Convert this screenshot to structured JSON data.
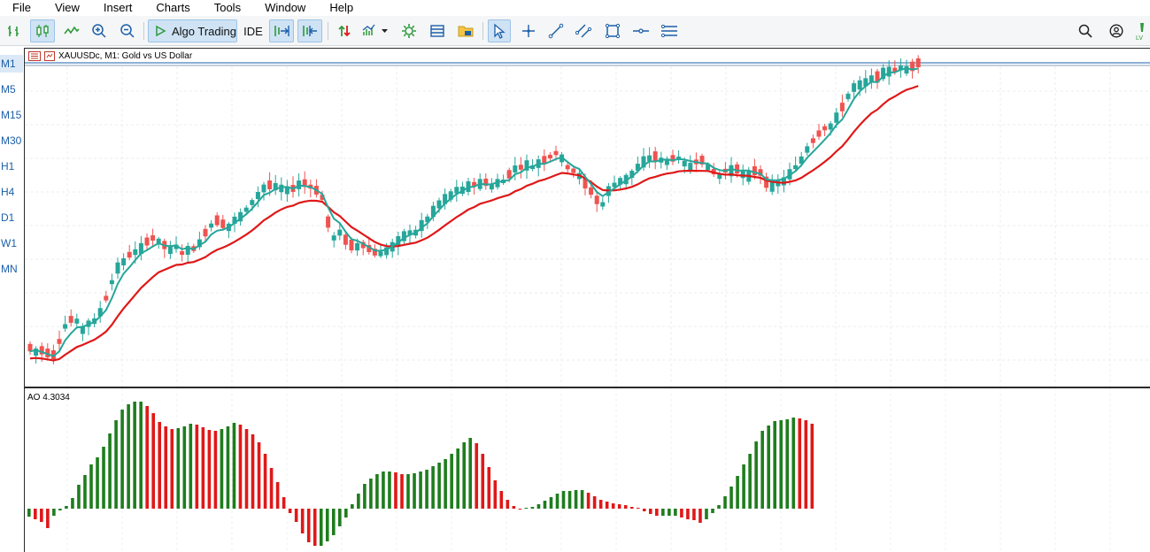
{
  "menu": [
    "File",
    "View",
    "Insert",
    "Charts",
    "Tools",
    "Window",
    "Help"
  ],
  "toolbar": {
    "algo_trading_label": "Algo Trading",
    "ide_label": "IDE",
    "colors": {
      "active_bg": "#cfe3f5",
      "icon_blue": "#1b5fa8",
      "icon_green": "#2e9a3c"
    }
  },
  "timeframes": [
    "M1",
    "M5",
    "M15",
    "M30",
    "H1",
    "H4",
    "D1",
    "W1",
    "MN"
  ],
  "active_timeframe": "M1",
  "chart": {
    "symbol_title": "XAUUSDc, M1:  Gold vs US Dollar",
    "ao_label": "AO 4.3034",
    "colors": {
      "bull": "#26a69a",
      "bear": "#ef5350",
      "fast_ma": "#26a69a",
      "slow_ma": "#e01818",
      "ao_up": "#1e7d1e",
      "ao_down": "#e01818"
    }
  },
  "chart_data": [
    {
      "type": "candlestick",
      "candles_approx": [
        [
          0,
          392
        ],
        [
          1,
          397
        ],
        [
          2,
          395
        ],
        [
          3,
          398
        ],
        [
          4,
          400
        ],
        [
          5,
          385
        ],
        [
          6,
          368
        ],
        [
          7,
          360
        ],
        [
          8,
          362
        ],
        [
          9,
          372
        ],
        [
          10,
          365
        ],
        [
          11,
          362
        ],
        [
          12,
          352
        ],
        [
          13,
          336
        ],
        [
          14,
          318
        ],
        [
          15,
          302
        ],
        [
          16,
          295
        ],
        [
          17,
          287
        ],
        [
          18,
          284
        ],
        [
          19,
          280
        ],
        [
          20,
          272
        ],
        [
          21,
          268
        ],
        [
          22,
          272
        ],
        [
          23,
          276
        ],
        [
          24,
          282
        ],
        [
          25,
          278
        ],
        [
          26,
          285
        ],
        [
          27,
          282
        ],
        [
          28,
          280
        ],
        [
          29,
          274
        ],
        [
          30,
          262
        ],
        [
          31,
          254
        ],
        [
          32,
          248
        ],
        [
          33,
          252
        ],
        [
          34,
          256
        ],
        [
          35,
          248
        ],
        [
          36,
          244
        ],
        [
          37,
          236
        ],
        [
          38,
          228
        ],
        [
          39,
          220
        ],
        [
          40,
          212
        ],
        [
          41,
          208
        ],
        [
          42,
          210
        ],
        [
          43,
          212
        ],
        [
          44,
          214
        ],
        [
          45,
          212
        ],
        [
          46,
          208
        ],
        [
          47,
          206
        ],
        [
          48,
          210
        ],
        [
          49,
          214
        ],
        [
          50,
          222
        ],
        [
          51,
          250
        ],
        [
          52,
          268
        ],
        [
          53,
          262
        ],
        [
          54,
          270
        ],
        [
          55,
          276
        ],
        [
          56,
          278
        ],
        [
          57,
          276
        ],
        [
          58,
          280
        ],
        [
          59,
          284
        ],
        [
          60,
          286
        ],
        [
          61,
          283
        ],
        [
          62,
          278
        ],
        [
          63,
          272
        ],
        [
          64,
          266
        ],
        [
          65,
          262
        ],
        [
          66,
          262
        ],
        [
          67,
          254
        ],
        [
          68,
          247
        ],
        [
          69,
          238
        ],
        [
          70,
          230
        ],
        [
          71,
          224
        ],
        [
          72,
          220
        ],
        [
          73,
          214
        ],
        [
          74,
          214
        ],
        [
          75,
          210
        ],
        [
          76,
          207
        ],
        [
          77,
          207
        ],
        [
          78,
          205
        ],
        [
          79,
          210
        ],
        [
          80,
          206
        ],
        [
          81,
          204
        ],
        [
          82,
          196
        ],
        [
          83,
          190
        ],
        [
          84,
          188
        ],
        [
          85,
          186
        ],
        [
          86,
          188
        ],
        [
          87,
          184
        ],
        [
          88,
          180
        ],
        [
          89,
          176
        ],
        [
          90,
          172
        ],
        [
          91,
          178
        ],
        [
          92,
          188
        ],
        [
          93,
          192
        ],
        [
          94,
          198
        ],
        [
          95,
          206
        ],
        [
          96,
          215
        ],
        [
          97,
          225
        ],
        [
          98,
          230
        ],
        [
          99,
          215
        ],
        [
          100,
          208
        ],
        [
          101,
          204
        ],
        [
          102,
          202
        ],
        [
          103,
          196
        ],
        [
          104,
          188
        ],
        [
          105,
          182
        ],
        [
          106,
          178
        ],
        [
          107,
          176
        ],
        [
          108,
          180
        ],
        [
          109,
          182
        ],
        [
          110,
          178
        ],
        [
          111,
          178
        ],
        [
          112,
          184
        ],
        [
          113,
          188
        ],
        [
          114,
          182
        ],
        [
          115,
          180
        ],
        [
          116,
          188
        ],
        [
          117,
          193
        ],
        [
          118,
          198
        ],
        [
          119,
          192
        ],
        [
          120,
          192
        ],
        [
          121,
          190
        ],
        [
          122,
          196
        ],
        [
          123,
          198
        ],
        [
          124,
          192
        ],
        [
          125,
          194
        ],
        [
          126,
          205
        ],
        [
          127,
          210
        ],
        [
          128,
          206
        ],
        [
          129,
          204
        ],
        [
          130,
          196
        ],
        [
          131,
          188
        ],
        [
          132,
          180
        ],
        [
          133,
          168
        ],
        [
          134,
          158
        ],
        [
          135,
          150
        ],
        [
          136,
          144
        ],
        [
          137,
          142
        ],
        [
          138,
          132
        ],
        [
          139,
          120
        ],
        [
          140,
          108
        ],
        [
          141,
          98
        ],
        [
          142,
          95
        ],
        [
          143,
          92
        ],
        [
          144,
          88
        ],
        [
          145,
          86
        ],
        [
          146,
          82
        ],
        [
          147,
          80
        ],
        [
          148,
          78
        ],
        [
          149,
          76
        ],
        [
          150,
          78
        ],
        [
          151,
          74
        ],
        [
          152,
          70
        ]
      ],
      "note_units": "price-axis not visible; values are relative chart levels"
    },
    {
      "type": "bar",
      "title": "AO 4.3034",
      "values": [
        -9,
        -12,
        -15,
        -22,
        -8,
        -2,
        3,
        12,
        27,
        38,
        50,
        58,
        70,
        85,
        100,
        112,
        118,
        121,
        121,
        116,
        108,
        98,
        93,
        90,
        91,
        93,
        96,
        95,
        92,
        89,
        88,
        90,
        93,
        97,
        95,
        90,
        84,
        75,
        62,
        46,
        30,
        13,
        -5,
        -15,
        -28,
        -38,
        -42,
        -42,
        -37,
        -30,
        -20,
        -10,
        5,
        17,
        28,
        34,
        39,
        42,
        42,
        41,
        39,
        39,
        40,
        42,
        44,
        48,
        52,
        56,
        62,
        68,
        75,
        80,
        74,
        62,
        47,
        32,
        20,
        10,
        3,
        -1,
        0,
        2,
        5,
        9,
        13,
        17,
        20,
        20,
        21,
        21,
        18,
        14,
        10,
        8,
        6,
        5,
        4,
        2,
        0,
        -3,
        -6,
        -8,
        -8,
        -8,
        -8,
        -10,
        -12,
        -13,
        -16,
        -12,
        -5,
        4,
        14,
        25,
        37,
        50,
        62,
        76,
        88,
        94,
        99,
        100,
        101,
        103,
        102,
        100,
        96
      ]
    }
  ]
}
